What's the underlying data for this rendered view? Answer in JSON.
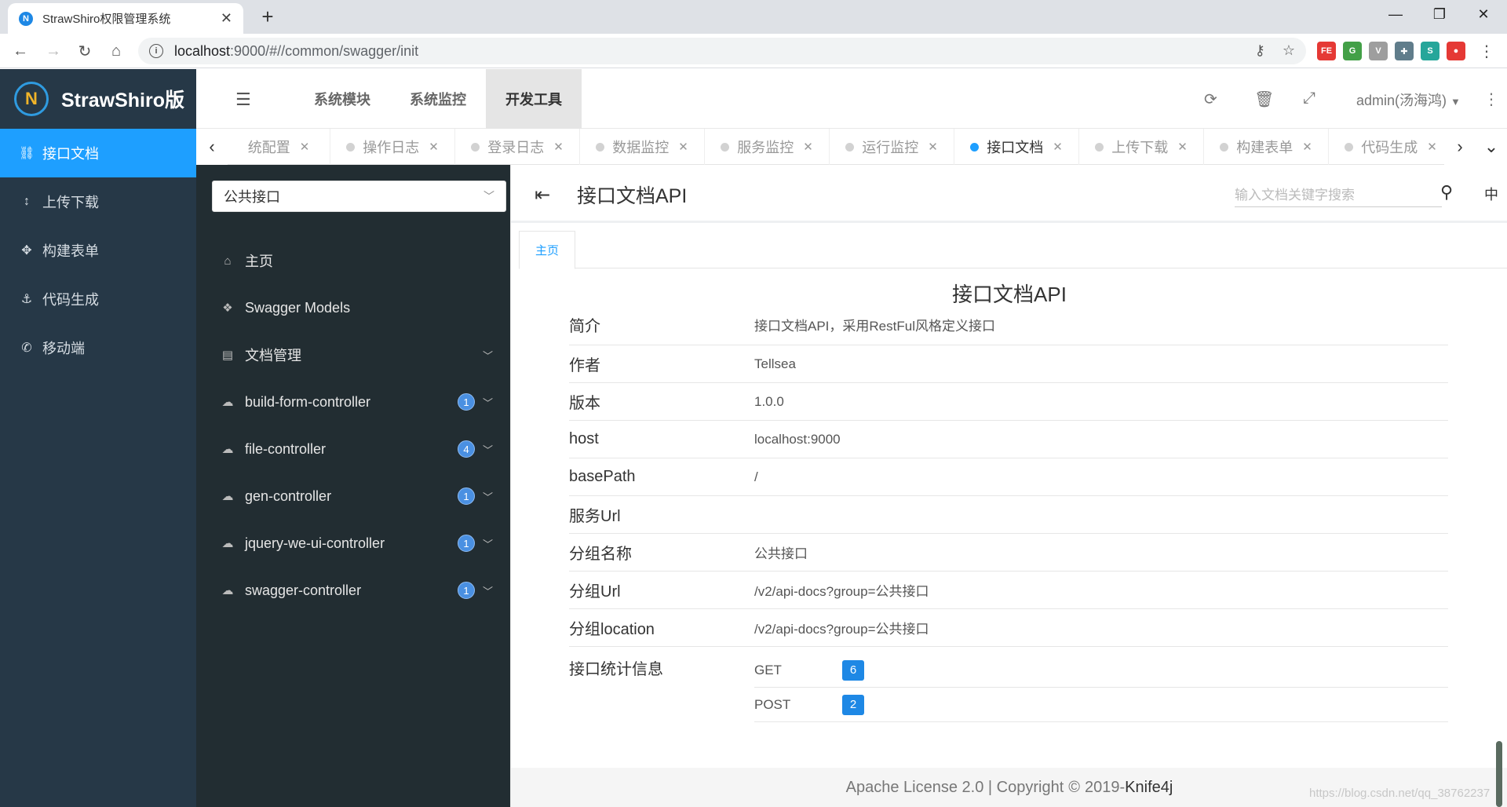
{
  "browser": {
    "tab_title": "StrawShiro权限管理系统",
    "favicon": "N",
    "url_host": "localhost",
    "url_rest": ":9000/#//common/swagger/init",
    "extensions": [
      {
        "label": "FE",
        "color": "#e53935"
      },
      {
        "label": "G",
        "color": "#43a047"
      },
      {
        "label": "V",
        "color": "#9e9e9e"
      },
      {
        "label": "✚",
        "color": "#607d8b"
      },
      {
        "label": "S",
        "color": "#26a69a"
      },
      {
        "label": "●",
        "color": "#e53935"
      }
    ]
  },
  "app": {
    "brand": "StrawShiro版",
    "top_nav": [
      "系统模块",
      "系统监控",
      "开发工具"
    ],
    "active_top_nav": "开发工具",
    "user": "admin(汤海鸿)"
  },
  "sidebar": {
    "items": [
      {
        "label": "接口文档",
        "icon": "sitemap-icon",
        "glyph": "⛓",
        "active": true
      },
      {
        "label": "上传下载",
        "icon": "updown-arrow-icon",
        "glyph": "↕",
        "active": false
      },
      {
        "label": "构建表单",
        "icon": "move-icon",
        "glyph": "✥",
        "active": false
      },
      {
        "label": "代码生成",
        "icon": "anchor-icon",
        "glyph": "⚓",
        "active": false
      },
      {
        "label": "移动端",
        "icon": "whatsapp-icon",
        "glyph": "✆",
        "active": false
      }
    ]
  },
  "page_tabs": [
    {
      "label": "统配置",
      "active": false
    },
    {
      "label": "操作日志",
      "active": false
    },
    {
      "label": "登录日志",
      "active": false
    },
    {
      "label": "数据监控",
      "active": false
    },
    {
      "label": "服务监控",
      "active": false
    },
    {
      "label": "运行监控",
      "active": false
    },
    {
      "label": "接口文档",
      "active": true
    },
    {
      "label": "上传下载",
      "active": false
    },
    {
      "label": "构建表单",
      "active": false
    },
    {
      "label": "代码生成",
      "active": false
    }
  ],
  "knife4j": {
    "group_select": "公共接口",
    "menu": [
      {
        "label": "主页",
        "icon": "home-icon",
        "glyph": "⌂",
        "badge": null,
        "arrow": false
      },
      {
        "label": "Swagger Models",
        "icon": "cube-icon",
        "glyph": "❖",
        "badge": null,
        "arrow": false
      },
      {
        "label": "文档管理",
        "icon": "doc-manage-icon",
        "glyph": "▤",
        "badge": null,
        "arrow": true
      },
      {
        "label": "build-form-controller",
        "icon": "cloud-icon",
        "glyph": "☁",
        "badge": "1",
        "arrow": true
      },
      {
        "label": "file-controller",
        "icon": "cloud-icon",
        "glyph": "☁",
        "badge": "4",
        "arrow": true
      },
      {
        "label": "gen-controller",
        "icon": "cloud-icon",
        "glyph": "☁",
        "badge": "1",
        "arrow": true
      },
      {
        "label": "jquery-we-ui-controller",
        "icon": "cloud-icon",
        "glyph": "☁",
        "badge": "1",
        "arrow": true
      },
      {
        "label": "swagger-controller",
        "icon": "cloud-icon",
        "glyph": "☁",
        "badge": "1",
        "arrow": true
      }
    ],
    "title": "接口文档API",
    "search_placeholder": "输入文档关键字搜索",
    "lang": "中",
    "subtab": "主页",
    "doc_title": "接口文档API",
    "info_rows": [
      {
        "key": "简介",
        "value": "接口文档API，采用RestFul风格定义接口"
      },
      {
        "key": "作者",
        "value": "Tellsea"
      },
      {
        "key": "版本",
        "value": "1.0.0"
      },
      {
        "key": "host",
        "value": "localhost:9000"
      },
      {
        "key": "basePath",
        "value": "/"
      },
      {
        "key": "服务Url",
        "value": ""
      },
      {
        "key": "分组名称",
        "value": "公共接口"
      },
      {
        "key": "分组Url",
        "value": "/v2/api-docs?group=公共接口"
      },
      {
        "key": "分组location",
        "value": "/v2/api-docs?group=公共接口"
      }
    ],
    "stats_label": "接口统计信息",
    "stats": [
      {
        "method": "GET",
        "count": "6"
      },
      {
        "method": "POST",
        "count": "2"
      }
    ],
    "footer_text": "Apache License 2.0 | Copyright",
    "footer_copyright": "©",
    "footer_year": "2019-",
    "footer_brand": "Knife4j"
  },
  "watermark": "https://blog.csdn.net/qq_38762237"
}
